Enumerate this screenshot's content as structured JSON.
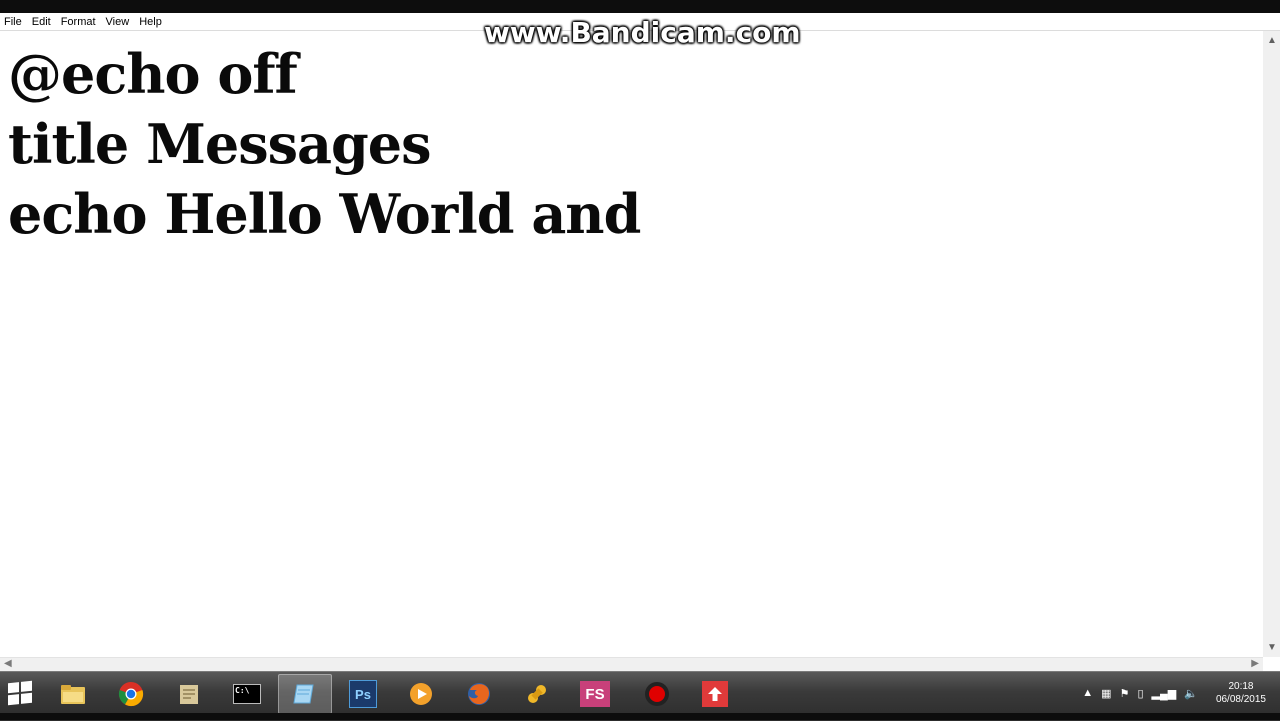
{
  "menu": [
    "File",
    "Edit",
    "Format",
    "View",
    "Help"
  ],
  "editor": {
    "lines": [
      "@echo off",
      "title Messages",
      "echo Hello World and"
    ]
  },
  "watermark": "www.Bandicam.com",
  "taskbar": {
    "apps": [
      {
        "name": "file-explorer-icon",
        "label": ""
      },
      {
        "name": "chrome-icon",
        "label": ""
      },
      {
        "name": "notes-icon",
        "label": ""
      },
      {
        "name": "command-prompt-icon",
        "label": "C:\\"
      },
      {
        "name": "notepad-icon",
        "label": ""
      },
      {
        "name": "photoshop-icon",
        "label": "Ps"
      },
      {
        "name": "media-player-icon",
        "label": ""
      },
      {
        "name": "firefox-icon",
        "label": ""
      },
      {
        "name": "tool-icon",
        "label": ""
      },
      {
        "name": "fs-app-icon",
        "label": "FS"
      },
      {
        "name": "record-icon",
        "label": ""
      },
      {
        "name": "upload-icon",
        "label": ""
      }
    ],
    "clock": {
      "time": "20:18",
      "date": "06/08/2015"
    }
  },
  "colors": {
    "photoshop": "#1b3a6b",
    "record": "#e00000",
    "upload": "#e03a3a",
    "fs": "#c8407a"
  }
}
